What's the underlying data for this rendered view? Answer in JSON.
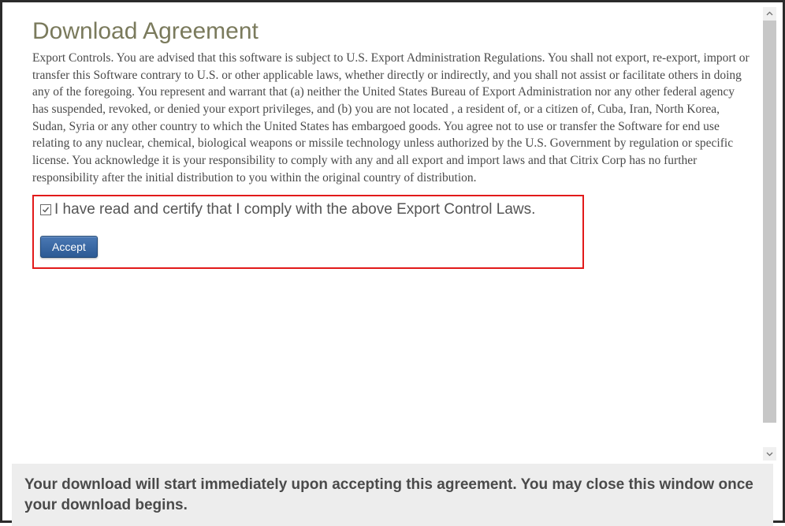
{
  "heading": "Download Agreement",
  "body_text": "Export Controls. You are advised that this software is subject to U.S. Export Administration Regulations. You shall not export, re-export, import or transfer this Software contrary to U.S. or other applicable laws, whether directly or indirectly, and you shall not assist or facilitate others in doing any of the foregoing. You represent and warrant that (a) neither the United States Bureau of Export Administration nor any other federal agency has suspended, revoked, or denied your export privileges, and (b) you are not located , a resident of, or a citizen of, Cuba, Iran, North Korea, Sudan, Syria or any other country to which the United States has embargoed goods. You agree not to use or transfer the Software for end use relating to any nuclear, chemical, biological weapons or missile technology unless authorized by the U.S. Government by regulation or specific license. You acknowledge it is your responsibility to comply with any and all export and import laws and that Citrix Corp has no further responsibility after the initial distribution to you within the original country of distribution.",
  "checkbox_label": "I have read and certify that I comply with the above Export Control Laws.",
  "checkbox_checked": true,
  "accept_button": "Accept",
  "footer_note": "Your download will start immediately upon accepting this agreement. You may close this window once your download begins."
}
